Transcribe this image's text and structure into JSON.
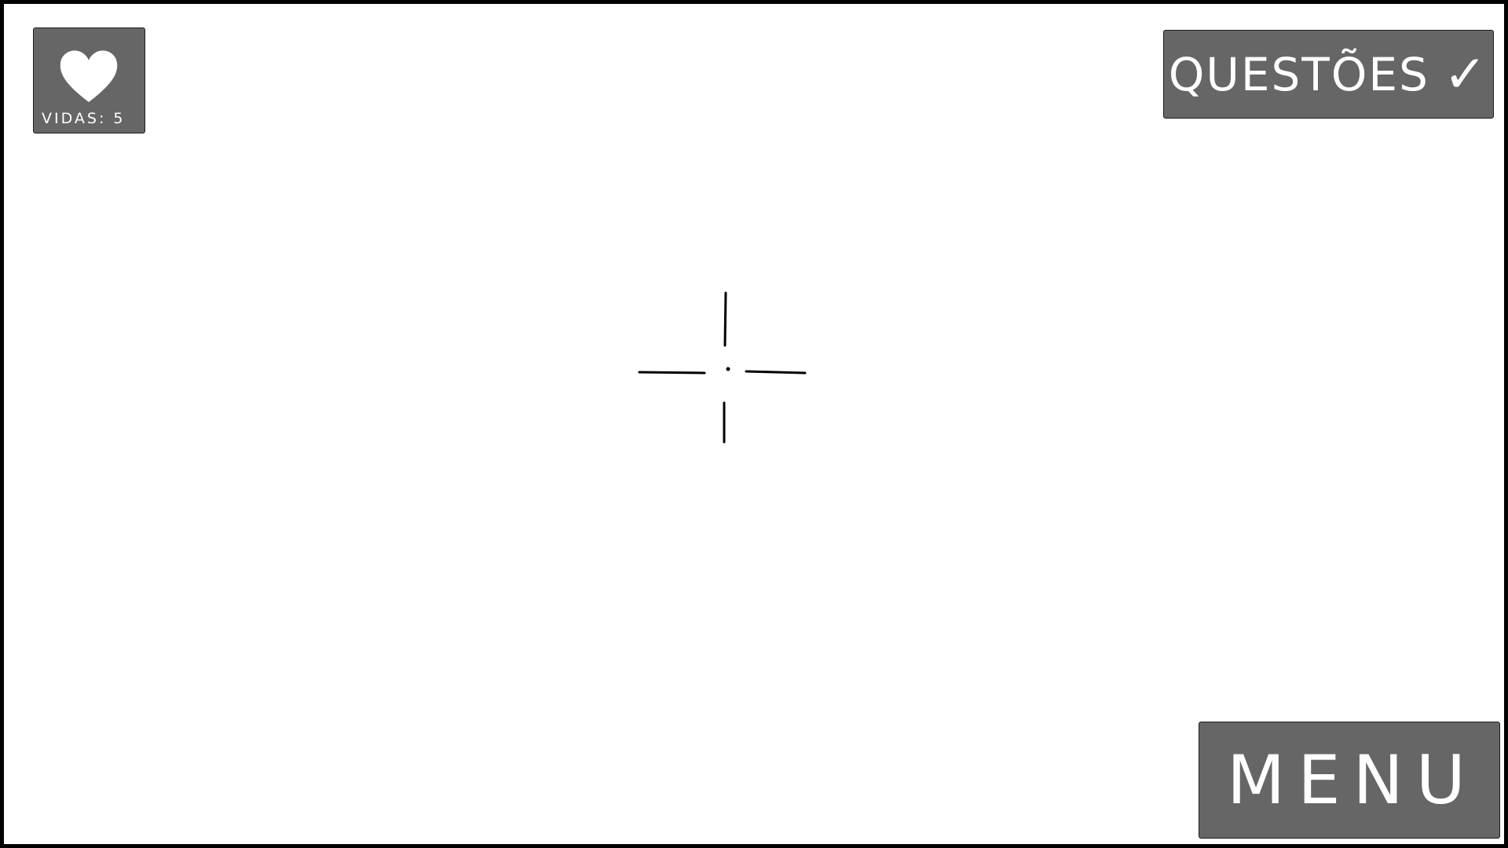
{
  "hud": {
    "lives_label": "VIDAS:",
    "lives_value": "5",
    "questions_label": "QUESTÕES",
    "questions_check": "✓",
    "menu_label": "MENU"
  },
  "colors": {
    "panel": "#666666",
    "text": "#ffffff",
    "background": "#ffffff",
    "border": "#000000"
  },
  "icons": {
    "lives": "heart-icon",
    "aim": "crosshair-icon"
  }
}
